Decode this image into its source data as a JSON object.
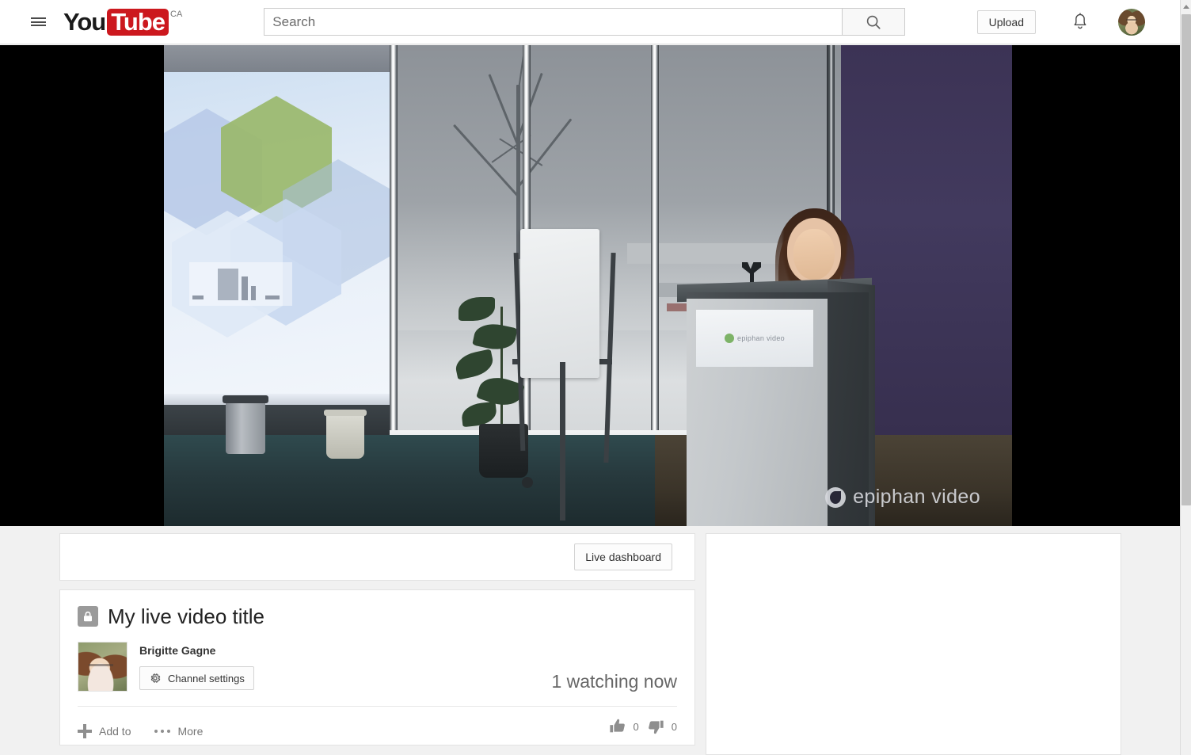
{
  "masthead": {
    "menu_icon": "hamburger-menu-icon",
    "logo": {
      "you": "You",
      "tube": "Tube",
      "country": "CA"
    },
    "search": {
      "value": "",
      "placeholder": "Search",
      "button_icon": "search-icon"
    },
    "upload_label": "Upload",
    "notifications_icon": "bell-icon",
    "account_avatar": "user-avatar"
  },
  "player": {
    "state": "playing",
    "letterbox_color": "#000000",
    "watermark": "epiphan video",
    "podium_sign": "epiphan video",
    "scene_description": "Presenter speaking at a podium in a conference room with projection screen, flip chart and snowy windows"
  },
  "dashboard_bar": {
    "live_dashboard_label": "Live dashboard"
  },
  "video_info": {
    "privacy_icon": "lock-icon",
    "title": "My live video title",
    "channel_name": "Brigitte Gagne",
    "channel_settings_label": "Channel settings",
    "channel_settings_icon": "gear-icon",
    "watching_now": "1 watching now",
    "actions": {
      "add_to_label": "Add to",
      "add_to_icon": "plus-icon",
      "more_label": "More",
      "more_icon": "ellipsis-icon"
    },
    "ratings": {
      "like_icon": "thumbs-up-icon",
      "like_count": "0",
      "dislike_icon": "thumbs-down-icon",
      "dislike_count": "0"
    }
  },
  "secondary": {
    "content": ""
  },
  "scrollbar": {
    "up_arrow_icon": "scroll-up-arrow-icon"
  },
  "colors": {
    "brand_red": "#cc181e",
    "page_bg": "#f1f1f1",
    "card_bg": "#ffffff",
    "text_primary": "#222222",
    "text_secondary": "#767676"
  }
}
